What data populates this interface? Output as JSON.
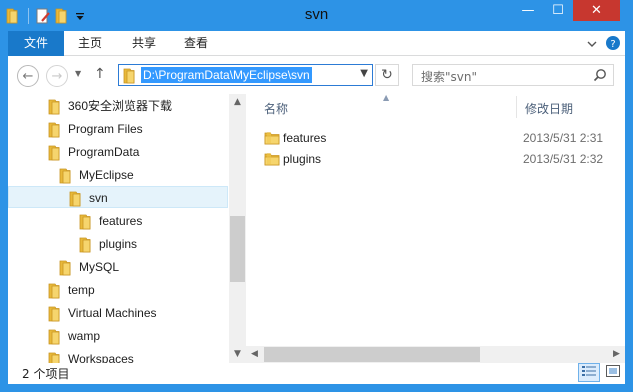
{
  "window": {
    "title": "svn",
    "controls": {
      "minimize": "—",
      "maximize": "☐",
      "close": "✕"
    }
  },
  "ribbon": {
    "tabs": [
      {
        "label": "文件"
      },
      {
        "label": "主页"
      },
      {
        "label": "共享"
      },
      {
        "label": "查看"
      }
    ]
  },
  "address": {
    "path": "D:\\ProgramData\\MyEclipse\\svn",
    "search_placeholder": "搜索\"svn\""
  },
  "nav_tree": [
    {
      "label": "360安全浏览器下载",
      "level": 0
    },
    {
      "label": "Program Files",
      "level": 0
    },
    {
      "label": "ProgramData",
      "level": 0
    },
    {
      "label": "MyEclipse",
      "level": 1
    },
    {
      "label": "svn",
      "level": 2,
      "selected": true
    },
    {
      "label": "features",
      "level": 3
    },
    {
      "label": "plugins",
      "level": 3
    },
    {
      "label": "MySQL",
      "level": 1
    },
    {
      "label": "temp",
      "level": 0
    },
    {
      "label": "Virtual Machines",
      "level": 0
    },
    {
      "label": "wamp",
      "level": 0
    },
    {
      "label": "Workspaces",
      "level": 0
    }
  ],
  "content": {
    "columns": [
      {
        "label": "名称"
      },
      {
        "label": "修改日期"
      }
    ],
    "files": [
      {
        "name": "features",
        "modified": "2013/5/31 2:31"
      },
      {
        "name": "plugins",
        "modified": "2013/5/31 2:32"
      }
    ]
  },
  "status": {
    "item_count": "2 个项目"
  },
  "colors": {
    "title_bar": "#2d93e6",
    "file_tab": "#1979ca",
    "close_button": "#c7372f",
    "selection": "#3399ff",
    "folder": "#e8b93a"
  }
}
